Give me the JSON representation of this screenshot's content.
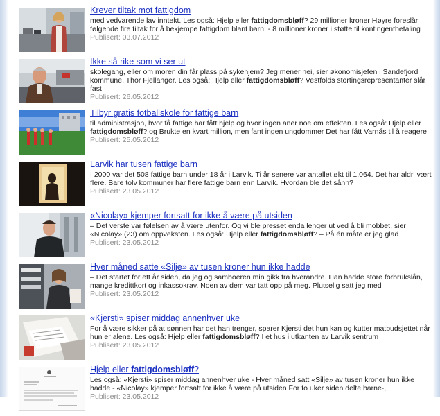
{
  "results": [
    {
      "title": "Krever tiltak mot fattigdom",
      "snippet_a": "med vedvarende lav inntekt. Les også: Hjelp eller ",
      "snippet_bold": "fattigdomsbløff",
      "snippet_b": "? 29 millioner kroner Høyre foreslår følgende fire tiltak for å bekjempe fattigdom blant barn: - 8 millioner kroner i støtte til kontingentbetaling",
      "date": "Publisert: 03.07.2012"
    },
    {
      "title": "Ikke så rike som vi ser ut",
      "snippet_a": "skolegang, eller om moren din får plass på sykehjem? Jeg mener nei, sier økonomisjefen i Sandefjord kommune, Thor Fjellanger. Les også: Hjelp eller ",
      "snippet_bold": "fattigdomsbløff",
      "snippet_b": "? Vestfolds stortingsrepresentanter slår fast",
      "date": "Publisert: 26.05.2012"
    },
    {
      "title": "Tilbyr gratis fotballskole for fattige barn",
      "snippet_a": "til administrasjon, hvor få fattige har fått hjelp og hvor ingen aner noe om effekten. Les også: Hjelp eller ",
      "snippet_bold": "fattigdomsbløff",
      "snippet_b": "? og Brukte en kvart million, men fant ingen ungdommer Det har fått Varnås til å reagere",
      "date": "Publisert: 25.05.2012"
    },
    {
      "title": "Larvik har tusen fattige barn",
      "snippet_a": "I 2000 var det 508 fattige barn under 18 år i Larvik. Ti år senere var antallet økt til 1.064. Det har aldri vært flere. Bare tolv kommuner har flere fattige barn enn Larvik. Hvordan ble det sånn?",
      "snippet_bold": "",
      "snippet_b": "",
      "date": "Publisert: 23.05.2012"
    },
    {
      "title": "«Nicolay» kjemper fortsatt for ikke å være på utsiden",
      "snippet_a": "– Det verste var følelsen av å være utenfor. Og vi ble presset enda lenger ut ved å bli mobbet, sier «Nicolay» (23) om oppveksten. Les også: Hjelp eller ",
      "snippet_bold": "fattigdomsbløff",
      "snippet_b": "? – På én måte er jeg glad",
      "date": "Publisert: 23.05.2012"
    },
    {
      "title": "Hver måned satte «Silje» av tusen kroner hun ikke hadde",
      "snippet_a": "– Det startet for ett år siden, da jeg og samboeren min gikk fra hverandre. Han hadde store forbrukslån, mange kredittkort og inkassokrav. Noen av dem var tatt opp på meg. Plutselig satt jeg med",
      "snippet_bold": "",
      "snippet_b": "",
      "date": "Publisert: 23.05.2012"
    },
    {
      "title": "«Kjersti» spiser middag annenhver uke",
      "snippet_a": "For å være sikker på at sønnen har det han trenger, sparer Kjersti det hun kan og kutter matbudsjettet når hun er alene. Les også: Hjelp eller ",
      "snippet_bold": "fattigdomsbløff",
      "snippet_b": "? I et hus i utkanten av Larvik sentrum",
      "date": "Publisert: 23.05.2012"
    },
    {
      "title_a": "Hjelp eller ",
      "title_bold": "fattigdomsbløff",
      "title_b": "?",
      "snippet_a": "Les også: «Kjersti» spiser middag annenhver uke - Hver måned satt «Silje» av tusen kroner hun ikke hadde - «Nicolay» kjemper fortsatt for ikke å være på utsiden For to uker siden delte barne-,",
      "snippet_bold": "",
      "snippet_b": "",
      "date": "Publisert: 23.05.2012"
    }
  ],
  "thumbnails": [
    "photo-woman-street",
    "photo-man-street",
    "photo-football-field",
    "photo-child-silhouette",
    "photo-young-man",
    "photo-woman-shopping",
    "photo-papers-table",
    "photo-document-scan"
  ],
  "colors": {
    "link": "#1d31c2",
    "date": "#8a8a8a",
    "text": "#222222"
  }
}
